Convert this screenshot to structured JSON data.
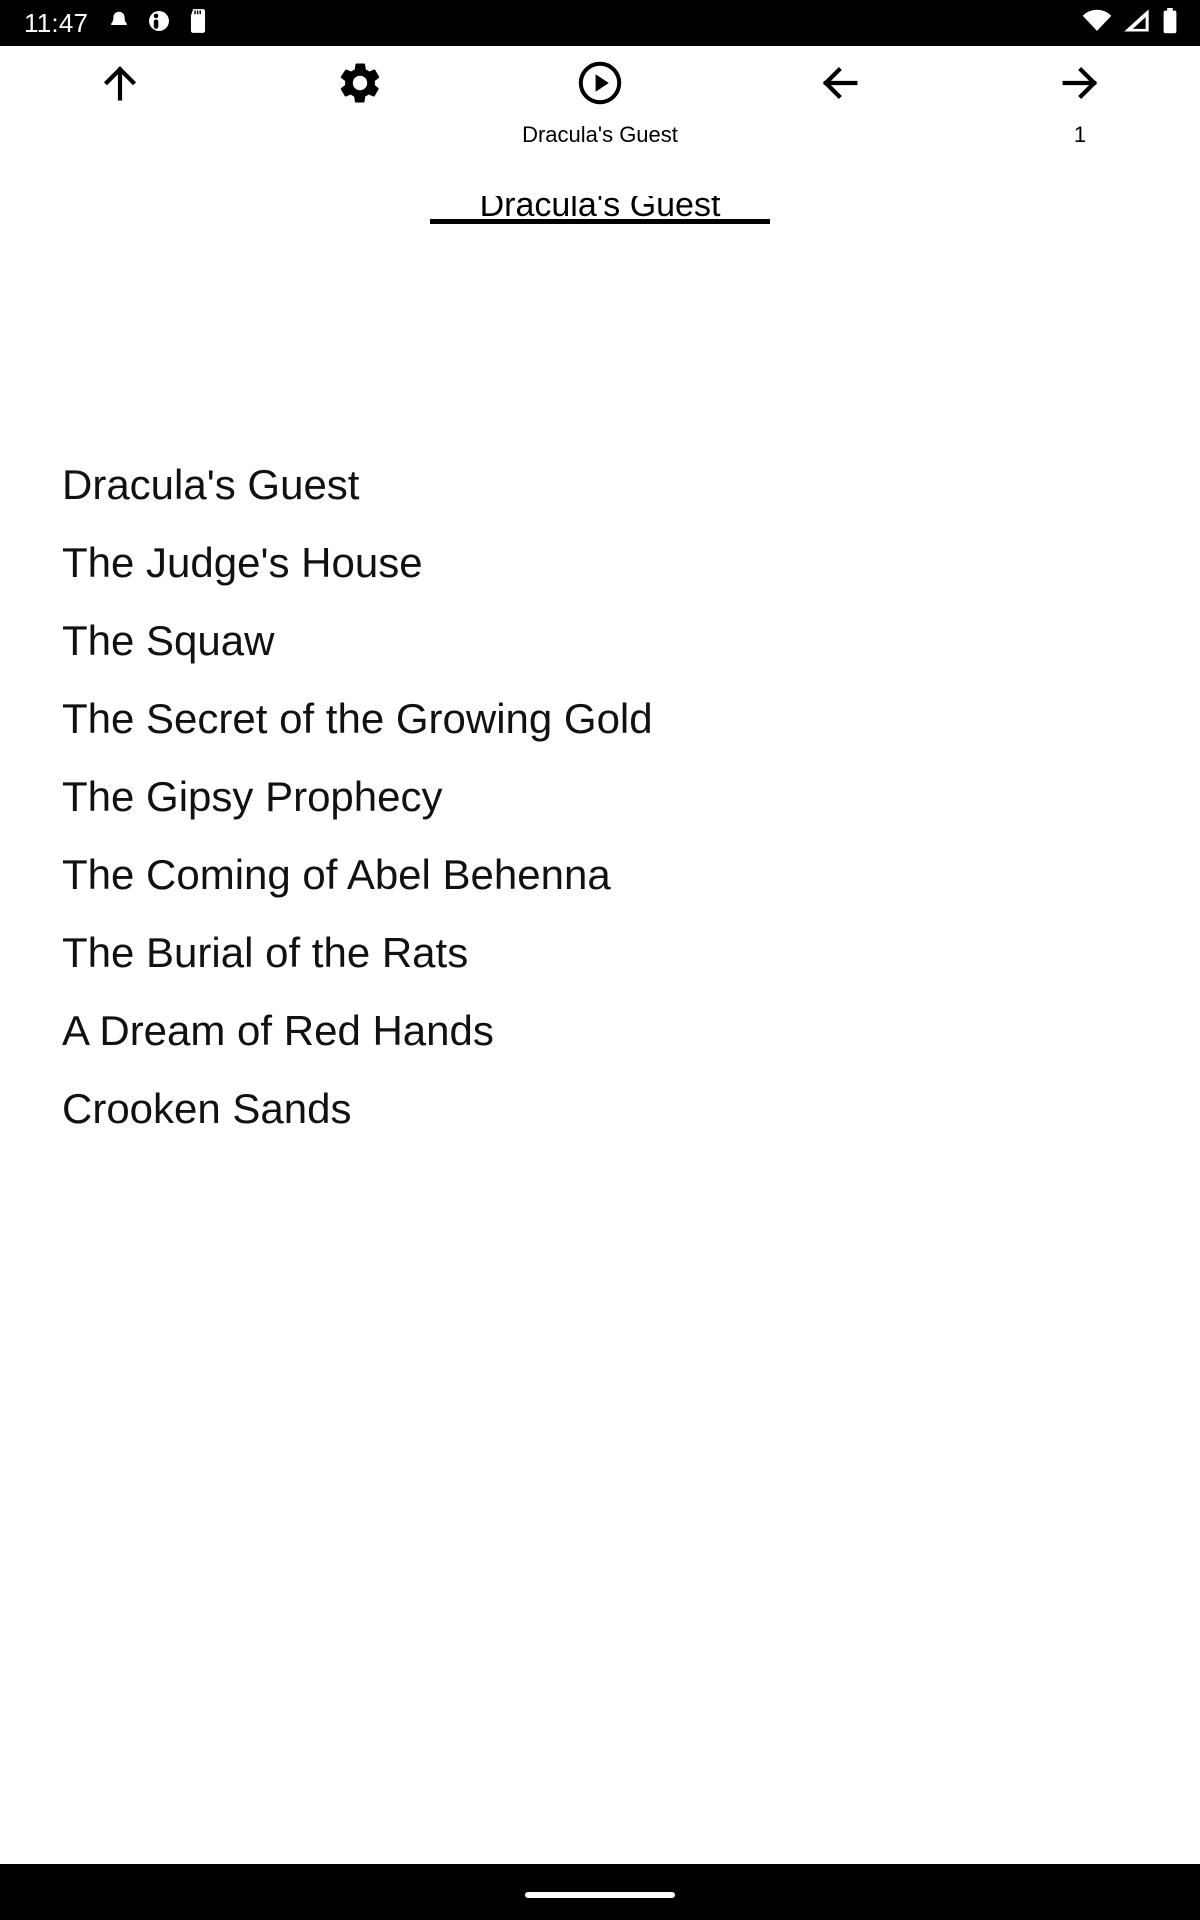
{
  "status_bar": {
    "clock": "11:47",
    "left_icons": [
      "notification-bell-icon",
      "app-badge-icon",
      "sd-card-icon"
    ],
    "right_icons": [
      "wifi-icon",
      "cellular-signal-icon",
      "battery-icon"
    ],
    "background_color": "#000000",
    "foreground_color": "#ffffff"
  },
  "toolbar": {
    "buttons": [
      {
        "name": "scroll-up-button",
        "icon": "arrow-up-icon",
        "sublabel": ""
      },
      {
        "name": "settings-button",
        "icon": "gear-icon",
        "sublabel": ""
      },
      {
        "name": "play-button",
        "icon": "play-circle-icon",
        "sublabel": "Dracula's Guest"
      },
      {
        "name": "previous-page-button",
        "icon": "arrow-left-icon",
        "sublabel": ""
      },
      {
        "name": "next-page-button",
        "icon": "arrow-right-icon",
        "sublabel": "1"
      }
    ],
    "current_title": "Dracula's Guest",
    "current_page": "1"
  },
  "main": {
    "stories": [
      "Dracula's Guest",
      "The Judge's House",
      "The Squaw",
      "The Secret of the Growing Gold",
      "The Gipsy Prophecy",
      "The Coming of Abel Behenna",
      "The Burial of the Rats",
      "A Dream of Red Hands",
      "Crooken Sands"
    ]
  },
  "nav_bar": {
    "gesture_pill": "home-gesture-pill",
    "background_color": "#000000"
  },
  "colors": {
    "background": "#ffffff",
    "text": "#111111",
    "bar": "#000000"
  }
}
